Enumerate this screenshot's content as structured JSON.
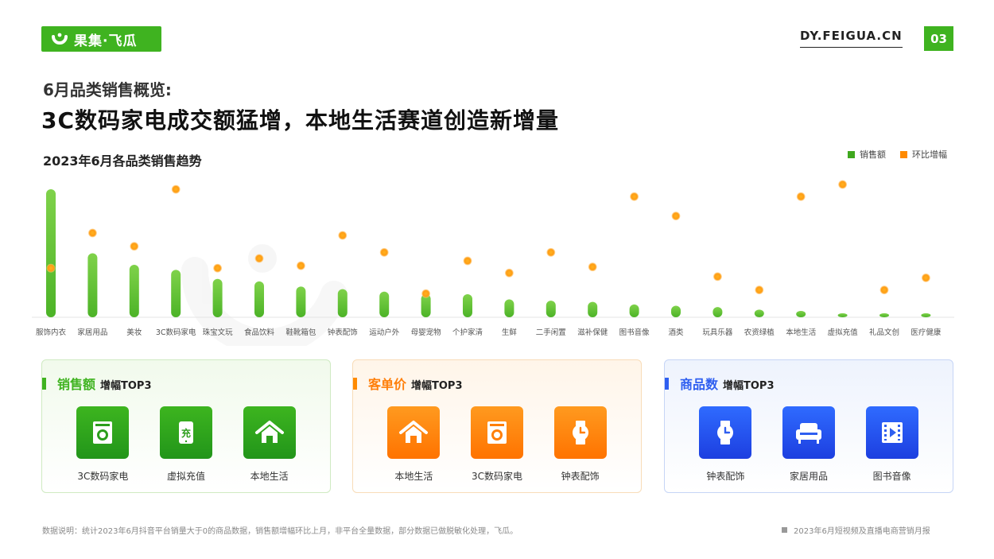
{
  "header": {
    "logo_text": "果集·飞瓜",
    "site": "DY.FEIGUA.CN",
    "page": "03"
  },
  "headline": {
    "subtitle": "6月品类销售概览:",
    "title": "3C数码家电成交额猛增，本地生活赛道创造新增量"
  },
  "colors": {
    "sales": "#5ec130",
    "growth": "#ffa51f",
    "green_accent": "#3fb320",
    "orange_accent": "#ff7f0a",
    "blue_accent": "#2f5ff0"
  },
  "legend": {
    "sales_label": "销售额",
    "growth_label": "环比增幅"
  },
  "chart_data": {
    "type": "bar",
    "title": "2023年6月各品类销售趋势",
    "categories": [
      "服饰内衣",
      "家居用品",
      "美妆",
      "3C数码家电",
      "珠宝文玩",
      "食品饮料",
      "鞋靴箱包",
      "钟表配饰",
      "运动户外",
      "母婴宠物",
      "个护家清",
      "生鲜",
      "二手闲置",
      "滋补保健",
      "图书音像",
      "酒类",
      "玩具乐器",
      "农资绿植",
      "本地生活",
      "虚拟充值",
      "礼品文创",
      "医疗健康"
    ],
    "series": [
      {
        "name": "销售额",
        "type": "bar",
        "values": [
          100,
          50,
          41,
          37,
          30,
          28,
          24,
          22,
          20,
          18,
          18,
          14,
          13,
          12,
          10,
          9,
          8,
          6,
          5,
          3,
          3,
          3
        ]
      },
      {
        "name": "环比增幅",
        "type": "scatter",
        "values": [
          32,
          61,
          50,
          97,
          32,
          40,
          34,
          59,
          45,
          11,
          38,
          28,
          45,
          33,
          91,
          75,
          25,
          14,
          91,
          101,
          14,
          24
        ]
      }
    ],
    "axes_shown": false,
    "legend_position": "top-right"
  },
  "panels": [
    {
      "keyword": "销售额",
      "suffix": "增幅TOP3",
      "items": [
        {
          "label": "3C数码家电",
          "icon": "washing-machine-icon"
        },
        {
          "label": "虚拟充值",
          "icon": "phone-recharge-icon"
        },
        {
          "label": "本地生活",
          "icon": "house-icon"
        }
      ]
    },
    {
      "keyword": "客单价",
      "suffix": "增幅TOP3",
      "items": [
        {
          "label": "本地生活",
          "icon": "house-icon"
        },
        {
          "label": "3C数码家电",
          "icon": "washing-machine-icon"
        },
        {
          "label": "钟表配饰",
          "icon": "watch-icon"
        }
      ]
    },
    {
      "keyword": "商品数",
      "suffix": "增幅TOP3",
      "items": [
        {
          "label": "钟表配饰",
          "icon": "watch-icon"
        },
        {
          "label": "家居用品",
          "icon": "sofa-icon"
        },
        {
          "label": "图书音像",
          "icon": "video-film-icon"
        }
      ]
    }
  ],
  "footer": {
    "note": "数据说明：统计2023年6月抖音平台销量大于0的商品数据，销售额增幅环比上月，非平台全量数据，部分数据已做脱敏化处理，飞瓜。",
    "report": "2023年6月短视频及直播电商营销月报"
  }
}
